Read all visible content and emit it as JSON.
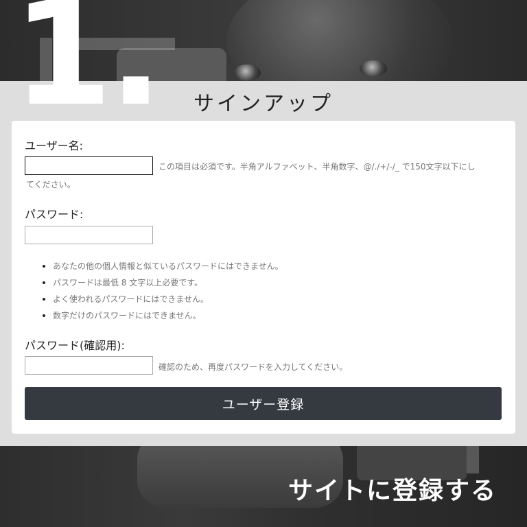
{
  "step_number": "1.",
  "title": "サインアップ",
  "form": {
    "username": {
      "label": "ユーザー名:",
      "value": "",
      "help_line1": "この項目は必須です。半角アルファベット、半角数字、@/./+/-/_ で150文字以下にし",
      "help_line2": "てください。"
    },
    "password": {
      "label": "パスワード:",
      "value": "",
      "rules": [
        "あなたの他の個人情報と似ているパスワードにはできません。",
        "パスワードは最低 8 文字以上必要です。",
        "よく使われるパスワードにはできません。",
        "数字だけのパスワードにはできません。"
      ]
    },
    "password_confirm": {
      "label": "パスワード(確認用):",
      "value": "",
      "help": "確認のため、再度パスワードを入力してください。"
    },
    "submit_label": "ユーザー登録"
  },
  "caption": "サイトに登録する",
  "colors": {
    "panel_bg": "#dedede",
    "button_bg": "#343a40",
    "caption_text": "#ffffff"
  }
}
